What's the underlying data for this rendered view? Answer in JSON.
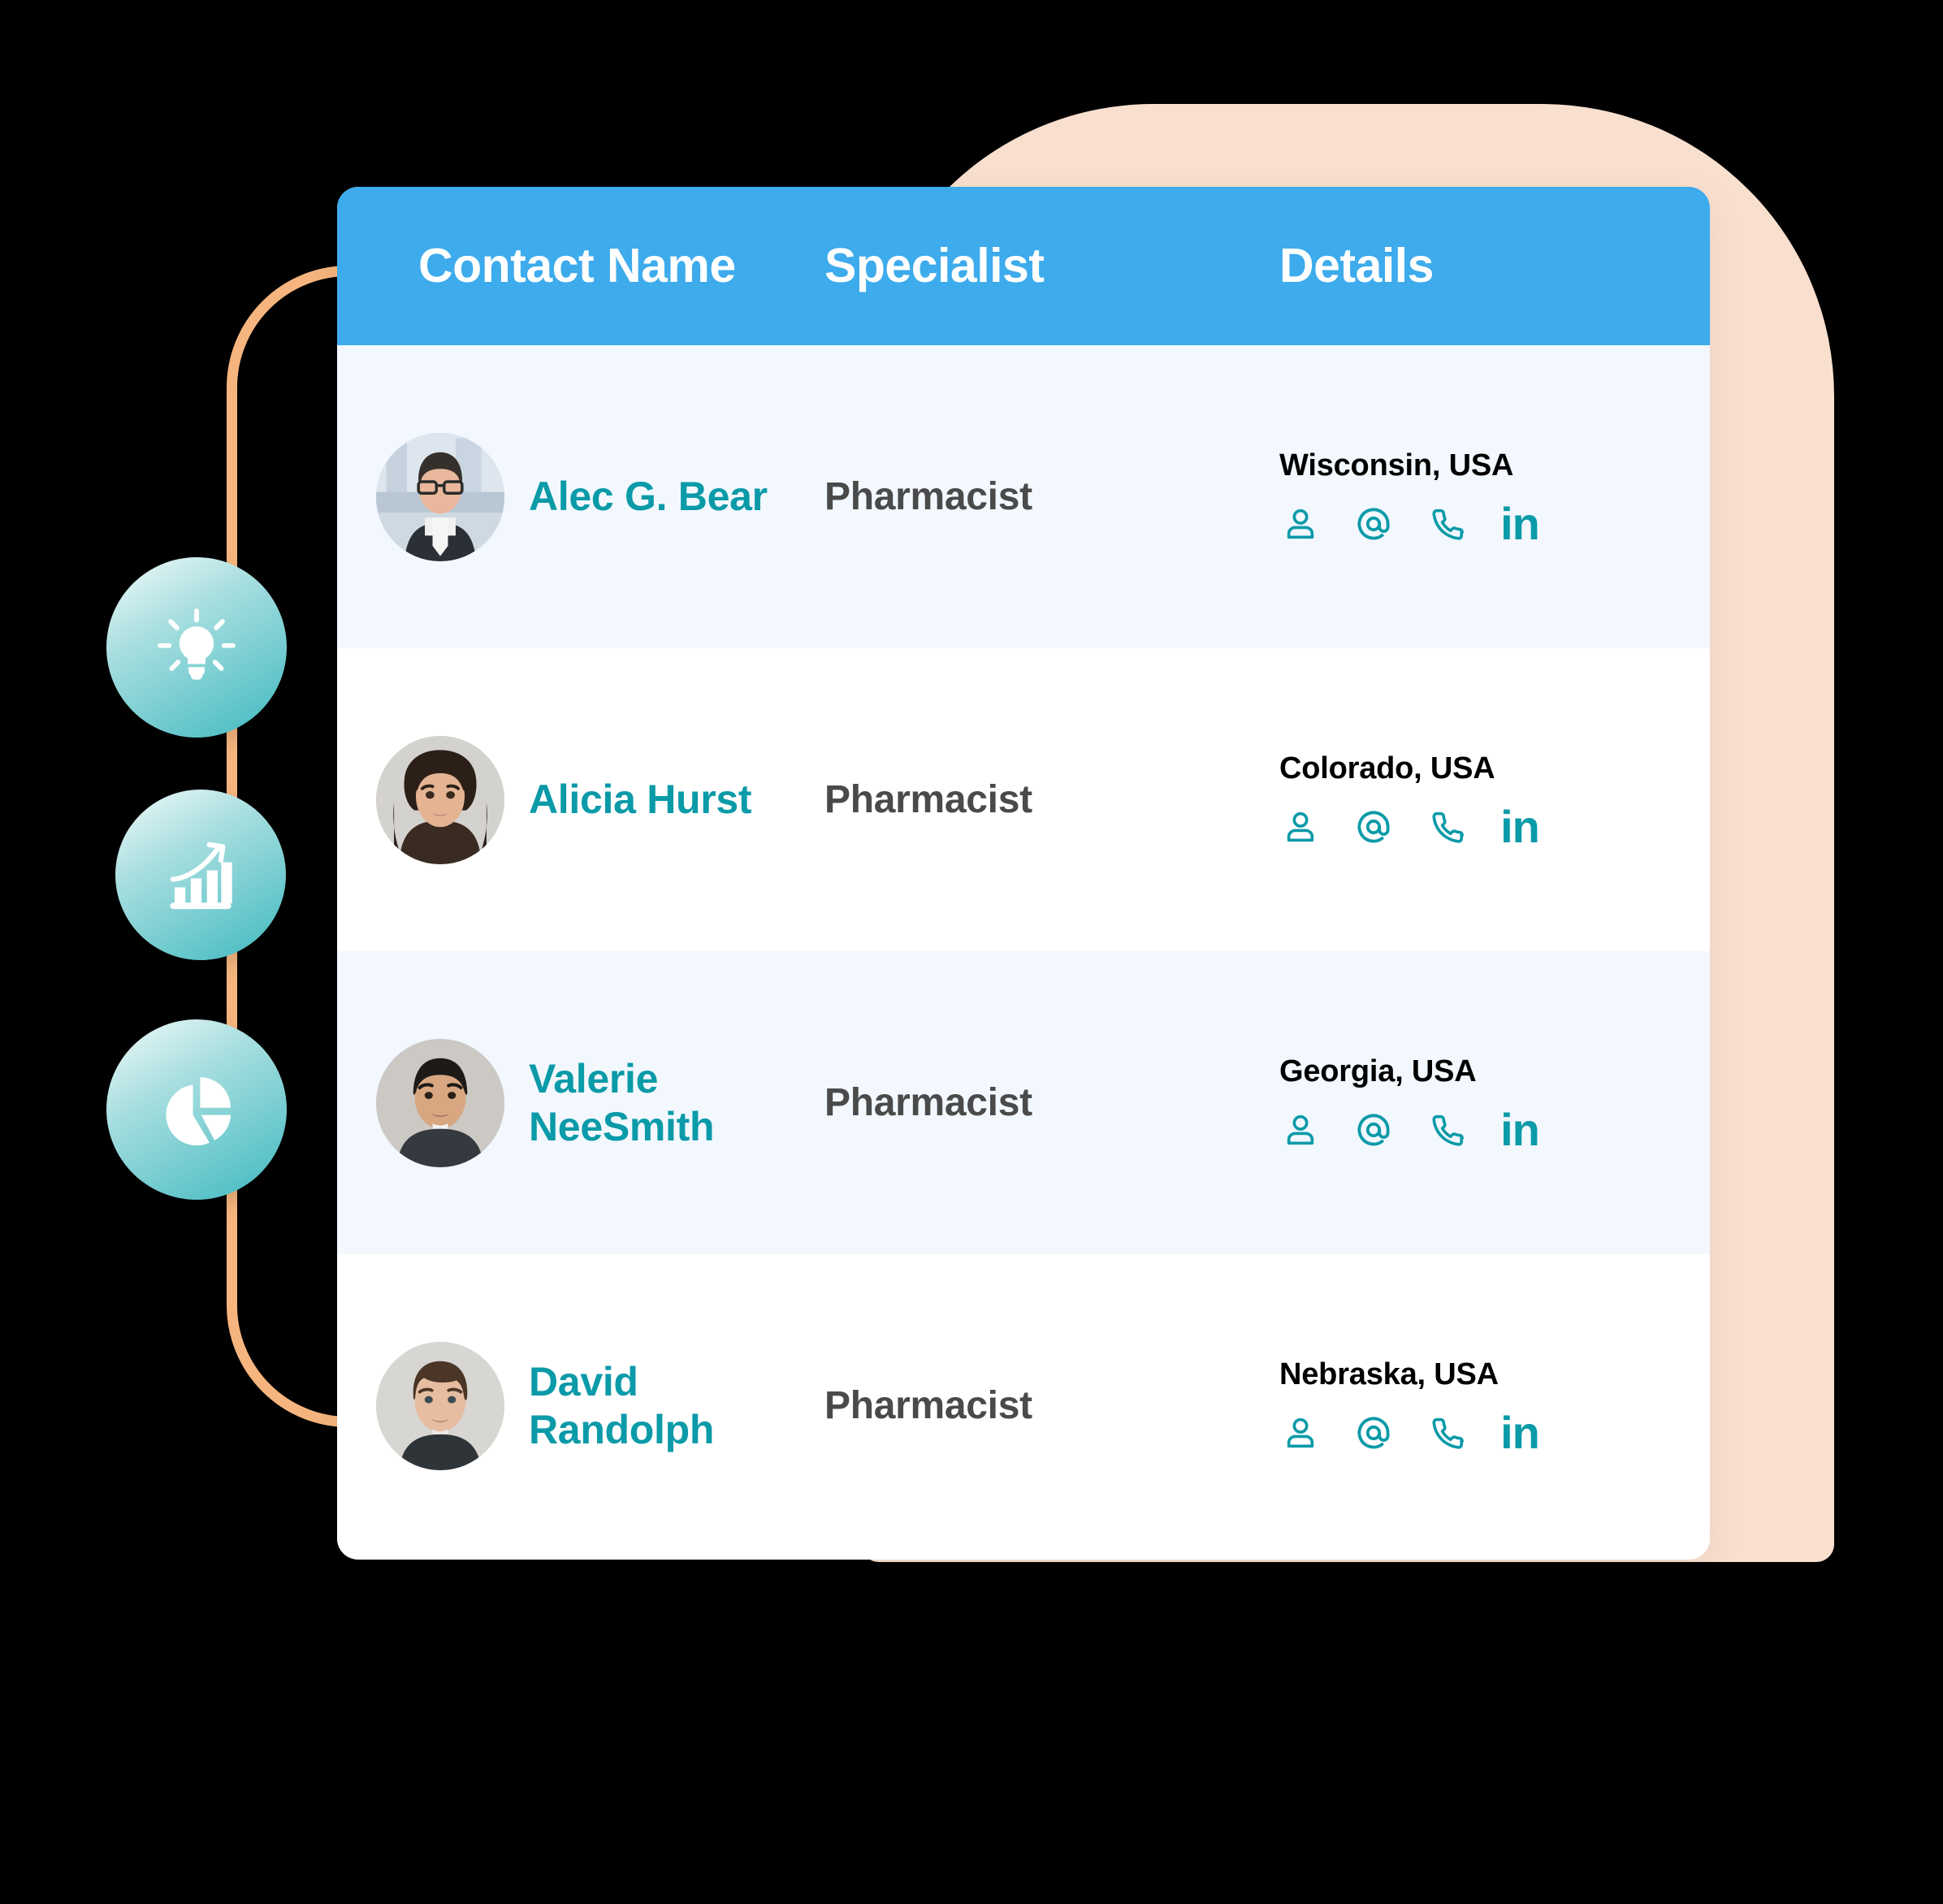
{
  "table": {
    "headers": {
      "contact_name": "Contact Name",
      "specialist": "Specialist",
      "details": "Details"
    },
    "rows": [
      {
        "name": "Alec G. Bear",
        "specialist": "Pharmacist",
        "location": "Wisconsin, USA",
        "icons": [
          "person-icon",
          "email-at-icon",
          "phone-icon",
          "linkedin-icon"
        ],
        "linkedin_label": "in"
      },
      {
        "name": "Alicia Hurst",
        "specialist": "Pharmacist",
        "location": "Colorado, USA",
        "icons": [
          "person-icon",
          "email-at-icon",
          "phone-icon",
          "linkedin-icon"
        ],
        "linkedin_label": "in"
      },
      {
        "name": "Valerie NeeSmith",
        "specialist": "Pharmacist",
        "location": "Georgia, USA",
        "icons": [
          "person-icon",
          "email-at-icon",
          "phone-icon",
          "linkedin-icon"
        ],
        "linkedin_label": "in"
      },
      {
        "name": "David Randolph",
        "specialist": "Pharmacist",
        "location": "Nebraska, USA",
        "icons": [
          "person-icon",
          "email-at-icon",
          "phone-icon",
          "linkedin-icon"
        ],
        "linkedin_label": "in"
      }
    ]
  },
  "badges": [
    {
      "icon": "lightbulb-icon"
    },
    {
      "icon": "growth-bar-chart-icon"
    },
    {
      "icon": "pie-chart-icon"
    }
  ],
  "colors": {
    "header_blue": "#3dabec",
    "accent_teal": "#0b9aa8",
    "row_alt": "#f2f8fe",
    "row_base": "#ffffff",
    "peach_backdrop": "#f8dfce",
    "outline_orange": "#f6b57e",
    "specialist_text": "#4a4a4a",
    "location_text": "#000000"
  }
}
